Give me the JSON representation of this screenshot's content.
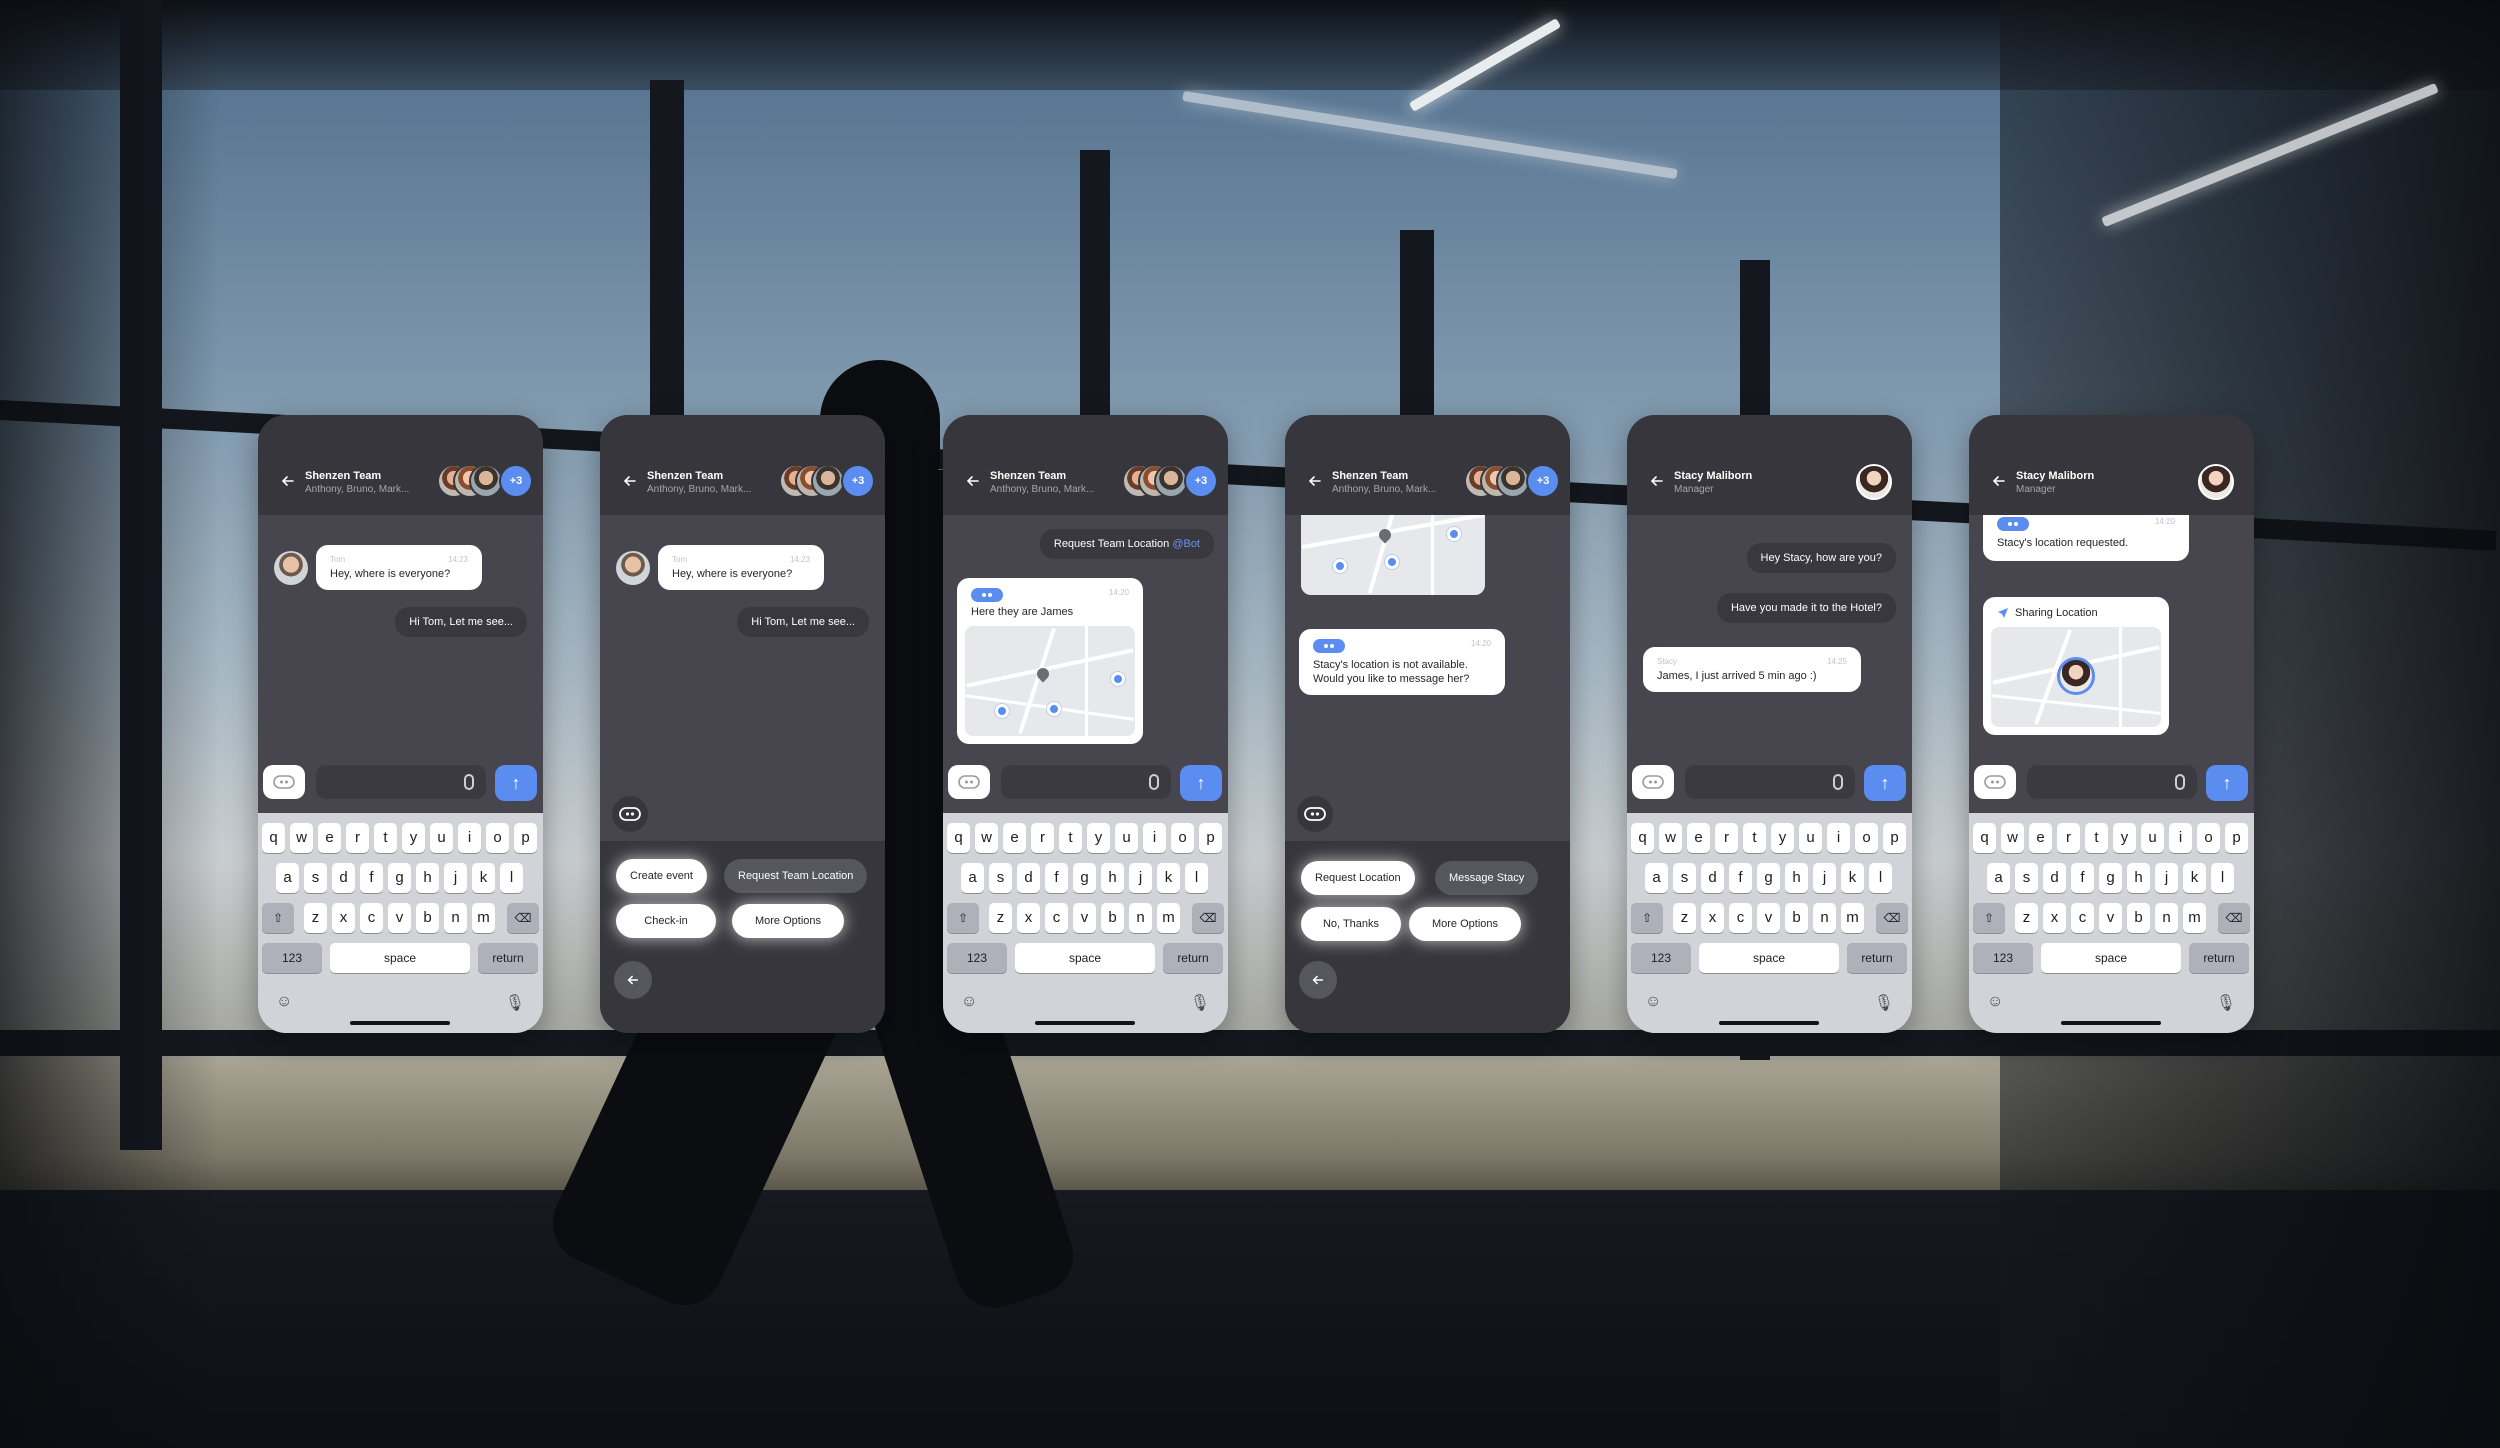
{
  "phones": [
    {
      "header": {
        "title": "Shenzen Team",
        "subtitle": "Anthony, Bruno, Mark...",
        "count_badge": "+3"
      },
      "messages": [
        {
          "sender": "Tom",
          "time": "14:23",
          "text": "Hey, where is everyone?"
        },
        {
          "text": "Hi Tom, Let me see..."
        }
      ]
    },
    {
      "header": {
        "title": "Shenzen Team",
        "subtitle": "Anthony, Bruno, Mark...",
        "count_badge": "+3"
      },
      "messages": [
        {
          "sender": "Tom",
          "time": "14:23",
          "text": "Hey, where is everyone?"
        },
        {
          "text": "Hi Tom, Let me see..."
        }
      ],
      "actions": [
        "Create event",
        "Request Team Location",
        "Check-in",
        "More Options"
      ]
    },
    {
      "header": {
        "title": "Shenzen Team",
        "subtitle": "Anthony, Bruno, Mark...",
        "count_badge": "+3"
      },
      "messages": [
        {
          "text": "Request Team Location",
          "mention": "@Bot"
        },
        {
          "time": "14:20",
          "text": "Here they are James"
        }
      ]
    },
    {
      "header": {
        "title": "Shenzen Team",
        "subtitle": "Anthony, Bruno, Mark...",
        "count_badge": "+3"
      },
      "messages": [
        {
          "time": "14:20",
          "text_line1": "Stacy's location is not available.",
          "text_line2": "Would you like to message her?"
        }
      ],
      "actions": [
        "Request Location",
        "Message Stacy",
        "No, Thanks",
        "More Options"
      ]
    },
    {
      "header": {
        "title": "Stacy Maliborn",
        "subtitle": "Manager"
      },
      "messages": [
        {
          "text": "Hey Stacy, how are you?"
        },
        {
          "text": "Have you made it to the Hotel?"
        },
        {
          "sender": "Stacy",
          "time": "14:25",
          "text": "James, I just arrived 5 min ago :)"
        }
      ]
    },
    {
      "header": {
        "title": "Stacy Maliborn",
        "subtitle": "Manager"
      },
      "messages": [
        {
          "time": "14:20",
          "text": "Stacy's location requested."
        },
        {
          "text": "Sharing Location"
        }
      ]
    }
  ],
  "keyboard": {
    "row1": [
      "q",
      "w",
      "e",
      "r",
      "t",
      "y",
      "u",
      "i",
      "o",
      "p"
    ],
    "row2": [
      "a",
      "s",
      "d",
      "f",
      "g",
      "h",
      "j",
      "k",
      "l"
    ],
    "row3": [
      "z",
      "x",
      "c",
      "v",
      "b",
      "n",
      "m"
    ],
    "numbers": "123",
    "space": "space",
    "return": "return"
  },
  "colors": {
    "accent": "#5b8cf0",
    "chat_bg": "#47464e",
    "header_bg": "#36363c"
  }
}
